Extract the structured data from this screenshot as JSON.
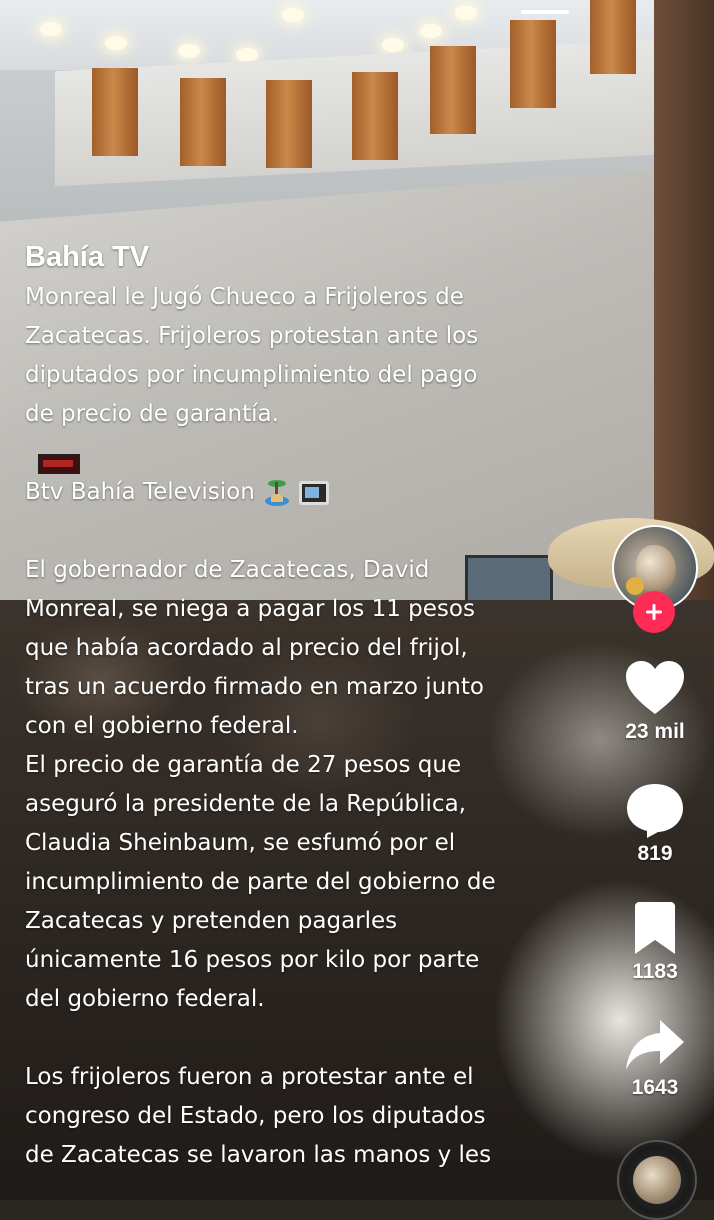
{
  "post": {
    "author": "Bahía TV",
    "caption": {
      "title_paragraph": "Monreal le Jugó Chueco a Frijoleros de\nZacatecas. Frijoleros protestan ante los\ndiputados por incumplimiento del pago\nde precio de garantía.",
      "channel_line": "Btv Bahía Television",
      "channel_emojis": [
        "island-emoji",
        "television-emoji"
      ],
      "body_paragraph": "El gobernador de Zacatecas, David\nMonreal, se niega a pagar los 11 pesos\nque había acordado al precio del frijol,\ntras un acuerdo firmado en marzo junto\ncon el gobierno federal.\nEl precio de garantía de 27 pesos que\naseguró la presidente de la República,\nClaudia Sheinbaum, se esfumó por el\nincumplimiento de parte del gobierno de\nZacatecas y pretenden pagarles\núnicamente 16 pesos por kilo por parte\ndel gobierno federal.",
      "closing_paragraph": "Los frijoleros fueron a protestar ante el\ncongreso del Estado, pero los diputados\nde Zacatecas se lavaron las manos y les"
    }
  },
  "actions": {
    "follow_icon": "plus-icon",
    "like": {
      "icon": "heart-icon",
      "count": "23 mil"
    },
    "comment": {
      "icon": "comment-bubble-icon",
      "count": "819"
    },
    "save": {
      "icon": "bookmark-icon",
      "count": "1183"
    },
    "share": {
      "icon": "share-arrow-icon",
      "count": "1643"
    },
    "sound_disc_icon": "music-disc-icon"
  },
  "colors": {
    "follow_accent": "#fe2c55",
    "text": "#ffffff"
  }
}
